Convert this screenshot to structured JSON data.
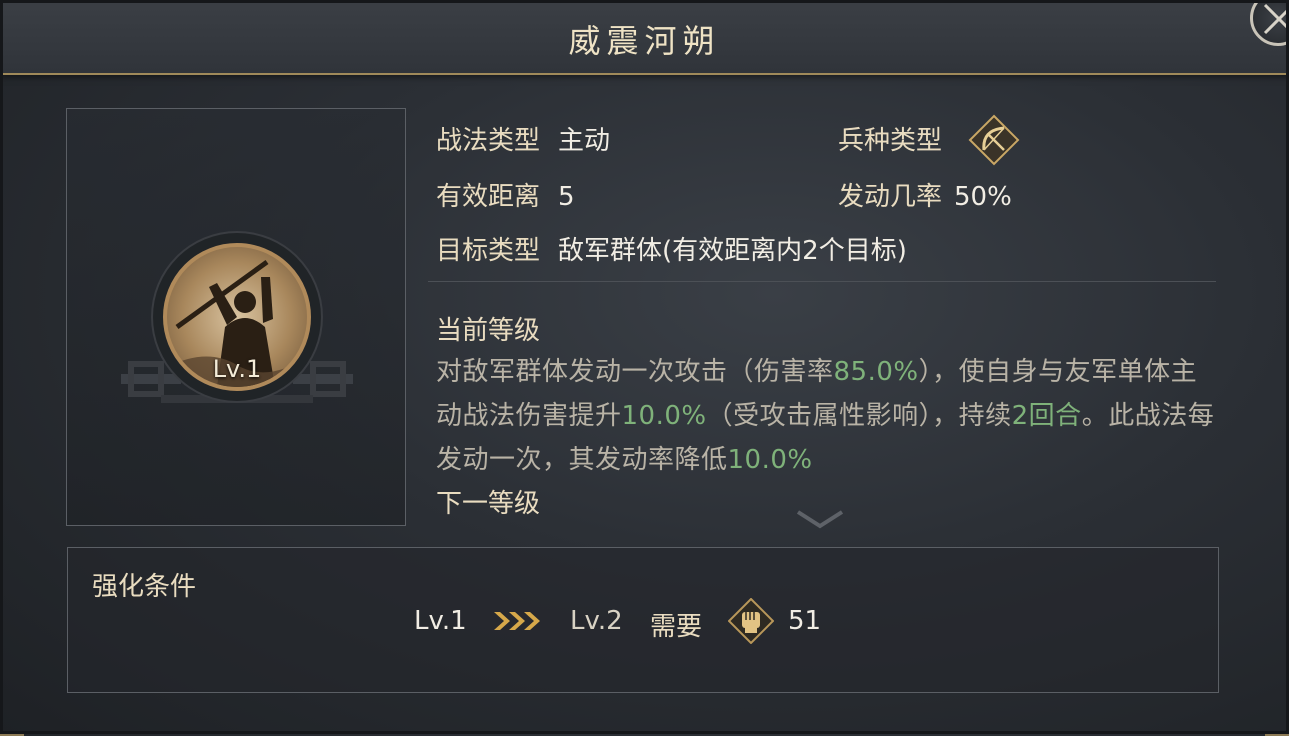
{
  "title": "威震河朔",
  "portrait": {
    "level_label": "Lv.1"
  },
  "info": {
    "tactic_type_label": "战法类型",
    "tactic_type_value": "主动",
    "troop_type_label": "兵种类型",
    "troop_type_icon": "bow-icon",
    "range_label": "有效距离",
    "range_value": "5",
    "trigger_rate_label": "发动几率",
    "trigger_rate_value": "50%",
    "target_label": "目标类型",
    "target_value": "敌军群体(有效距离内2个目标)"
  },
  "current_level": {
    "title": "当前等级",
    "desc_parts": {
      "p1": "对敌军群体发动一次攻击（伤害率",
      "v1": "85.0%",
      "p2": "），使自身与友军单体主动战法伤害提升",
      "v2": "10.0%",
      "p3": "（受攻击属性影响），持续",
      "v3": "2回合",
      "p4": "。此战法每发动一次，其发动率降低",
      "v4": "10.0%"
    }
  },
  "next_level": {
    "title": "下一等级"
  },
  "enhance": {
    "title": "强化条件",
    "from_level": "Lv.1",
    "to_level": "Lv.2",
    "need_label": "需要",
    "cost_icon": "fist-token-icon",
    "cost_value": "51"
  },
  "colors": {
    "accent_gold": "#a08a5a",
    "value_green": "#7fb27a",
    "arrow_gold": "#d6a84a"
  }
}
